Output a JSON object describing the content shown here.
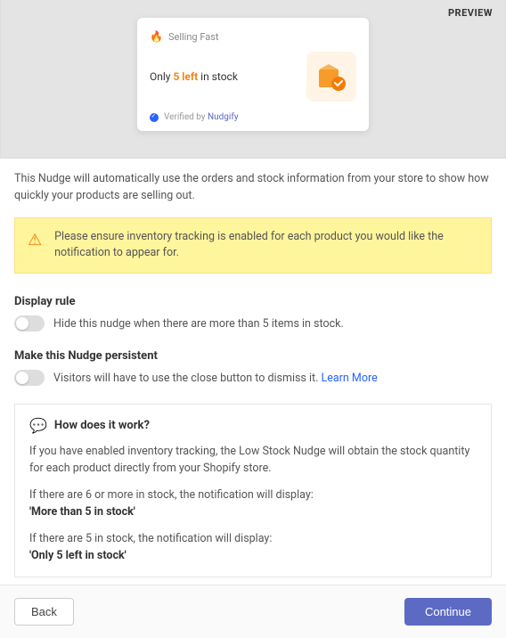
{
  "preview": {
    "badge": "PREVIEW",
    "nudge": {
      "headline_label": "Selling Fast",
      "body_prefix": "Only ",
      "qty_text": "5 left",
      "body_suffix": " in stock",
      "verified_prefix": "Verified by ",
      "brand": "Nudgify"
    }
  },
  "description": "This Nudge will automatically use the orders and stock information from your store to show how quickly your products are selling out.",
  "alert": "Please ensure inventory tracking is enabled for each product you would like the notification to appear for.",
  "display_rule": {
    "title": "Display rule",
    "label": "Hide this nudge when there are more than 5 items in stock."
  },
  "persistent": {
    "title": "Make this Nudge persistent",
    "label": "Visitors will have to use the close button to dismiss it. ",
    "link": "Learn More"
  },
  "info": {
    "title": "How does it work?",
    "p1": "If you have enabled inventory tracking, the Low Stock Nudge will obtain the stock quantity for each product directly from your Shopify store.",
    "p2a": "If there are 6 or more in stock, the notification will display:",
    "p2b": "'More than 5 in stock'",
    "p3a": "If there are 5 in stock, the notification will display:",
    "p3b": "'Only 5 left in stock'"
  },
  "footer": {
    "back": "Back",
    "continue": "Continue"
  }
}
